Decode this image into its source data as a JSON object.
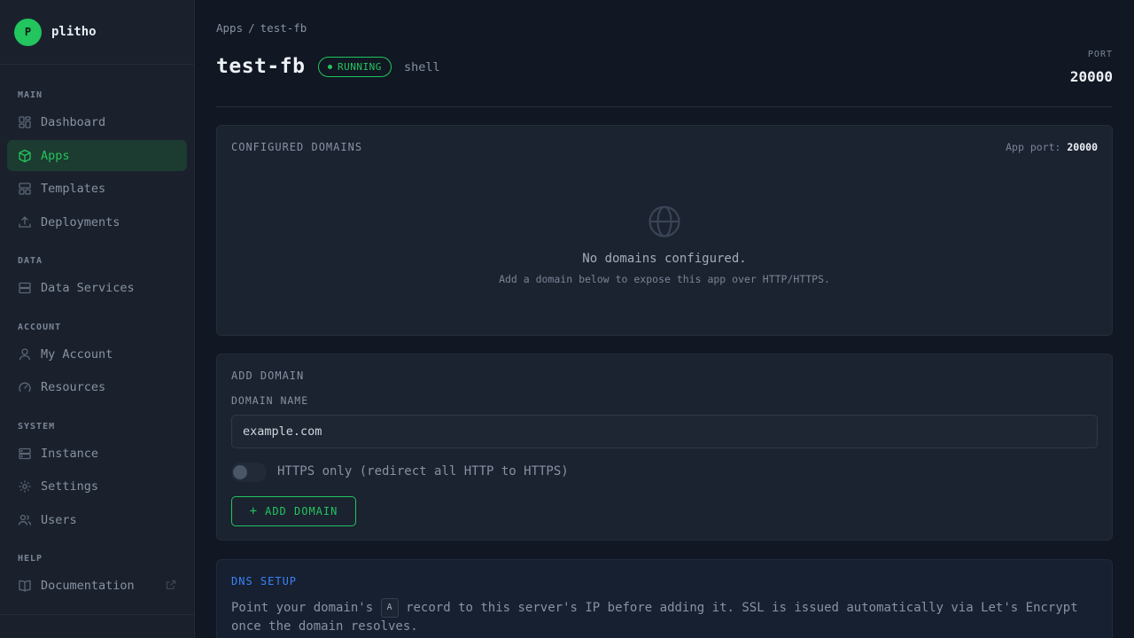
{
  "brand": {
    "avatar_letter": "P",
    "name": "plitho"
  },
  "sidebar": {
    "sections": [
      {
        "heading": "MAIN"
      },
      {
        "heading": "DATA"
      },
      {
        "heading": "ACCOUNT"
      },
      {
        "heading": "SYSTEM"
      },
      {
        "heading": "HELP"
      }
    ],
    "items": [
      {
        "label": "Dashboard",
        "icon": "dashboard-icon"
      },
      {
        "label": "Apps",
        "icon": "box-icon",
        "active": true
      },
      {
        "label": "Templates",
        "icon": "templates-icon"
      },
      {
        "label": "Deployments",
        "icon": "upload-icon"
      },
      {
        "label": "Data Services",
        "icon": "database-icon"
      },
      {
        "label": "My Account",
        "icon": "user-icon"
      },
      {
        "label": "Resources",
        "icon": "gauge-icon"
      },
      {
        "label": "Instance",
        "icon": "server-icon"
      },
      {
        "label": "Settings",
        "icon": "gear-icon"
      },
      {
        "label": "Users",
        "icon": "users-icon"
      },
      {
        "label": "Documentation",
        "icon": "book-icon",
        "external": true
      }
    ]
  },
  "breadcrumb": {
    "root": "Apps",
    "separator": "/",
    "current": "test-fb"
  },
  "header": {
    "title": "test-fb",
    "status": "RUNNING",
    "app_type": "shell",
    "port_label": "PORT",
    "port_value": "20000"
  },
  "domains_card": {
    "title": "CONFIGURED DOMAINS",
    "app_port_label": "App port:",
    "app_port_value": "20000",
    "empty_title": "No domains configured.",
    "empty_subtitle": "Add a domain below to expose this app over HTTP/HTTPS."
  },
  "add_domain": {
    "title": "ADD DOMAIN",
    "field_label": "DOMAIN NAME",
    "placeholder": "example.com",
    "https_only_label": "HTTPS only (redirect all HTTP to HTTPS)",
    "https_only_enabled": false,
    "button_label": "ADD DOMAIN"
  },
  "dns_setup": {
    "title": "DNS SETUP",
    "text_before": "Point your domain's",
    "record_type": "A",
    "text_after": "record to this server's IP before adding it. SSL is issued automatically via Let's Encrypt once the domain resolves."
  },
  "colors": {
    "accent": "#22c55e",
    "info": "#3b82f6",
    "background": "#111723",
    "sidebar": "#1a212d"
  }
}
